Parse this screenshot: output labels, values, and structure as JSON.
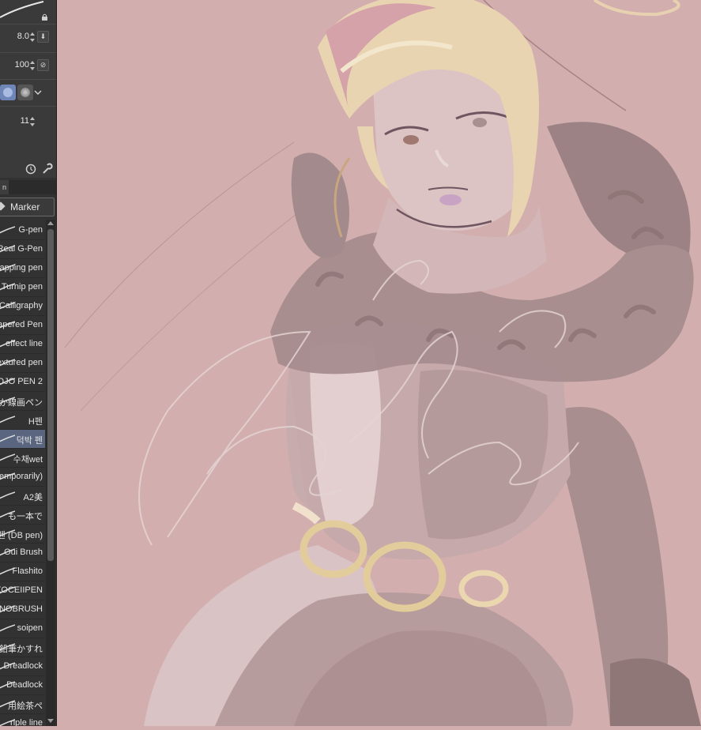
{
  "tool_property": {
    "brush_size": "8.0",
    "opacity": "100",
    "stabilization": "11"
  },
  "subtool_group": {
    "tab_label": "n",
    "group_label": "Marker"
  },
  "brushes": [
    {
      "name": "G-pen",
      "selected": false
    },
    {
      "name": "Real G-Pen",
      "selected": false
    },
    {
      "name": "apping pen",
      "selected": false
    },
    {
      "name": "Turnip pen",
      "selected": false
    },
    {
      "name": "Calligraphy",
      "selected": false
    },
    {
      "name": "apered Pen",
      "selected": false
    },
    {
      "name": "effect line",
      "selected": false
    },
    {
      "name": "extured pen",
      "selected": false
    },
    {
      "name": "OJO PEN 2",
      "selected": false
    },
    {
      "name": "か線画ペン",
      "selected": false
    },
    {
      "name": "H펜",
      "selected": false
    },
    {
      "name": "덕박 펜",
      "selected": true
    },
    {
      "name": "수채wet",
      "selected": false
    },
    {
      "name": "Temporarily)",
      "selected": false
    },
    {
      "name": "A2美",
      "selected": false
    },
    {
      "name": "も一本で",
      "selected": false
    },
    {
      "name": "펜 (DB pen)",
      "selected": false
    },
    {
      "name": "Oui Brush",
      "selected": false
    },
    {
      "name": "Flashito",
      "selected": false
    },
    {
      "name": "XOCEIIPEN",
      "selected": false
    },
    {
      "name": "NOBRUSH",
      "selected": false
    },
    {
      "name": "soipen",
      "selected": false
    },
    {
      "name": "鉛筆かすれ",
      "selected": false
    },
    {
      "name": "Dreadlock",
      "selected": false
    },
    {
      "name": "Deadlock",
      "selected": false
    },
    {
      "name": "用絵茶ペ",
      "selected": false
    },
    {
      "name": "riple line",
      "selected": false
    }
  ],
  "icons": {
    "lock": "lock-icon",
    "pressure": "pressure-icon",
    "blend": "blend-icon",
    "dropdown": "chevron-down-icon",
    "clock": "clock-icon",
    "wrench": "wrench-icon"
  },
  "colors": {
    "canvas_bg": "#d3aeae",
    "panel_bg": "#323232",
    "selected_row": "#5a6680",
    "hair": "#ecd7b4",
    "fur": "#9e8586"
  }
}
